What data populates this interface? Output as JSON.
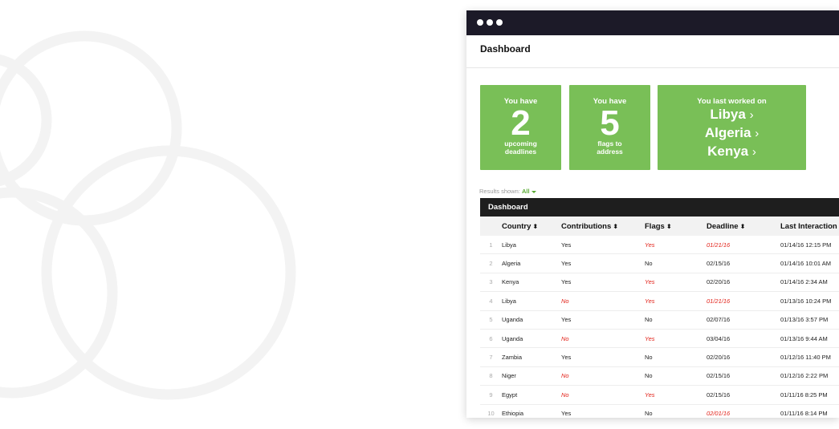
{
  "window": {
    "header_title": "Dashboard"
  },
  "cards": [
    {
      "top": "You have",
      "big": "2",
      "bottom1": "upcoming",
      "bottom2": "deadlines"
    },
    {
      "top": "You have",
      "big": "5",
      "bottom1": "flags to",
      "bottom2": "address"
    },
    {
      "top": "You last worked on",
      "links": [
        "Libya",
        "Algeria",
        "Kenya"
      ]
    }
  ],
  "results": {
    "label": "Results shown:",
    "value": "All"
  },
  "table": {
    "title": "Dashboard",
    "columns": [
      "Country",
      "Contributions",
      "Flags",
      "Deadline",
      "Last Interaction"
    ],
    "rows": [
      {
        "n": "1",
        "country": "Libya",
        "contrib": "Yes",
        "flags": "Yes",
        "deadline": "01/21/16",
        "last": "01/14/16 12:15 PM",
        "contrib_alert": false,
        "flags_alert": true,
        "deadline_alert": true
      },
      {
        "n": "2",
        "country": "Algeria",
        "contrib": "Yes",
        "flags": "No",
        "deadline": "02/15/16",
        "last": "01/14/16 10:01 AM",
        "contrib_alert": false,
        "flags_alert": false,
        "deadline_alert": false
      },
      {
        "n": "3",
        "country": "Kenya",
        "contrib": "Yes",
        "flags": "Yes",
        "deadline": "02/20/16",
        "last": "01/14/16 2:34 AM",
        "contrib_alert": false,
        "flags_alert": true,
        "deadline_alert": false
      },
      {
        "n": "4",
        "country": "Libya",
        "contrib": "No",
        "flags": "Yes",
        "deadline": "01/21/16",
        "last": "01/13/16 10:24 PM",
        "contrib_alert": true,
        "flags_alert": true,
        "deadline_alert": true
      },
      {
        "n": "5",
        "country": "Uganda",
        "contrib": "Yes",
        "flags": "No",
        "deadline": "02/07/16",
        "last": "01/13/16 3:57 PM",
        "contrib_alert": false,
        "flags_alert": false,
        "deadline_alert": false
      },
      {
        "n": "6",
        "country": "Uganda",
        "contrib": "No",
        "flags": "Yes",
        "deadline": "03/04/16",
        "last": "01/13/16 9:44 AM",
        "contrib_alert": true,
        "flags_alert": true,
        "deadline_alert": false
      },
      {
        "n": "7",
        "country": "Zambia",
        "contrib": "Yes",
        "flags": "No",
        "deadline": "02/20/16",
        "last": "01/12/16 11:40 PM",
        "contrib_alert": false,
        "flags_alert": false,
        "deadline_alert": false
      },
      {
        "n": "8",
        "country": "Niger",
        "contrib": "No",
        "flags": "No",
        "deadline": "02/15/16",
        "last": "01/12/16 2:22 PM",
        "contrib_alert": true,
        "flags_alert": false,
        "deadline_alert": false
      },
      {
        "n": "9",
        "country": "Egypt",
        "contrib": "No",
        "flags": "Yes",
        "deadline": "02/15/16",
        "last": "01/11/16 8:25 PM",
        "contrib_alert": true,
        "flags_alert": true,
        "deadline_alert": false
      },
      {
        "n": "10",
        "country": "Ethiopia",
        "contrib": "Yes",
        "flags": "No",
        "deadline": "02/01/16",
        "last": "01/11/16 8:14 PM",
        "contrib_alert": false,
        "flags_alert": false,
        "deadline_alert": true
      }
    ]
  },
  "colors": {
    "titlebar": "#1c1a28",
    "card_green": "#79bf57",
    "alert_red": "#e2231a",
    "table_header": "#1e1e1e"
  }
}
